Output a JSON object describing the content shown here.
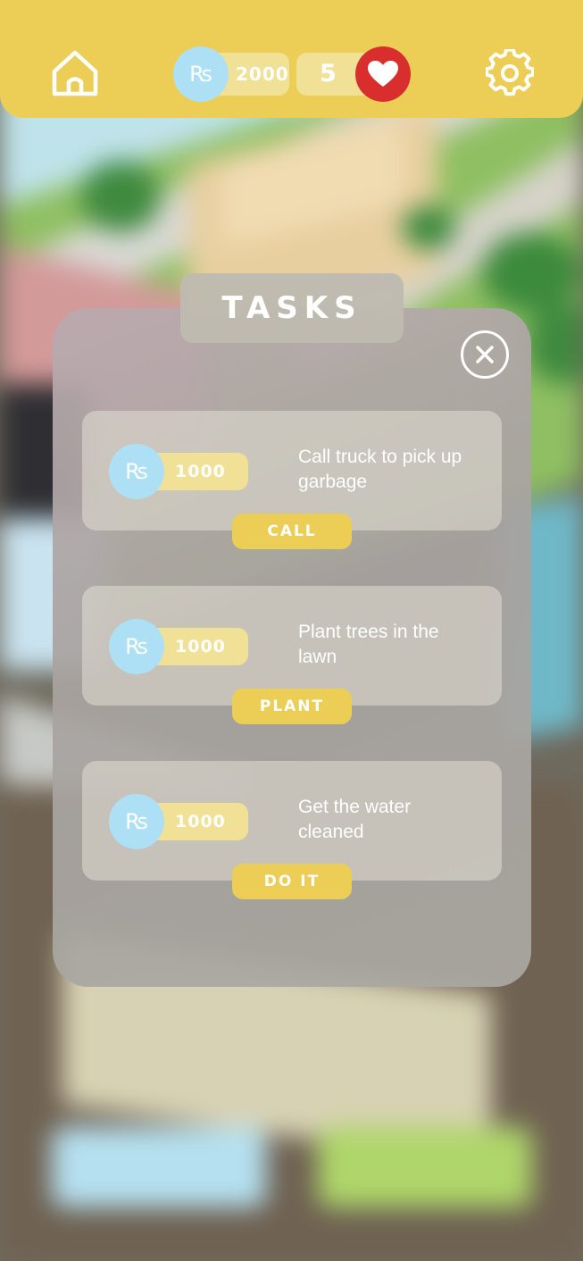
{
  "hud": {
    "home_icon": "home-icon",
    "currency_symbol": "₨",
    "coins": "2000",
    "lives": "5",
    "heart_icon": "heart-icon",
    "settings_icon": "gear-icon"
  },
  "tasks_modal": {
    "title": "TASKS",
    "close_icon": "close-icon",
    "items": [
      {
        "reward": "1000",
        "description": "Call truck to pick up garbage",
        "action": "CALL"
      },
      {
        "reward": "1000",
        "description": "Plant trees in the lawn",
        "action": "PLANT"
      },
      {
        "reward": "1000",
        "description": "Get the water cleaned",
        "action": "DO IT"
      }
    ]
  },
  "colors": {
    "hud_yellow": "#ecce56",
    "coin_blue": "#ade0f4",
    "heart_red": "#d92e2e",
    "pill_yellow": "#f1e197"
  }
}
